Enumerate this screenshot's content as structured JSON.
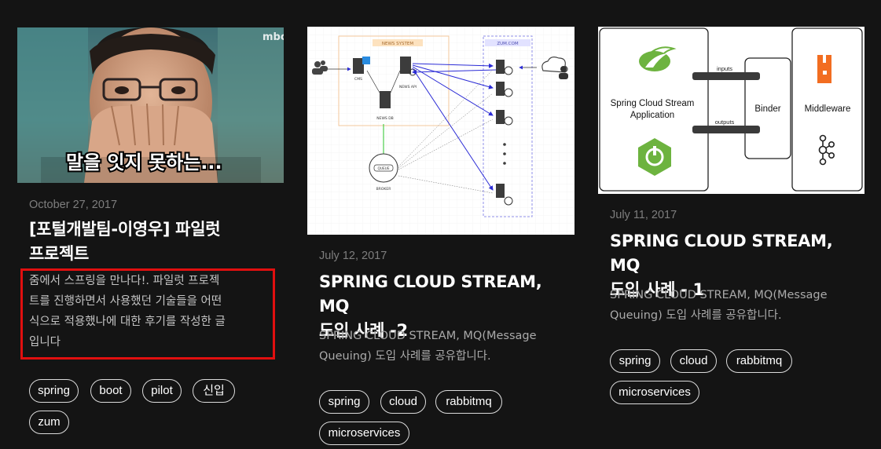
{
  "posts": [
    {
      "image_caption": "말을 잇지 못하는...",
      "image_logo": "mbc",
      "date": "October 27, 2017",
      "title": "[포털개발팀-이영우] 파일럿 프로젝트",
      "title_lines": [
        "[포털개발팀-이영우] 파일럿",
        "프로젝트"
      ],
      "desc_lines": [
        "줌에서 스프링을 만나다!. 파일럿 프로젝",
        "트를 진행하면서 사용했던 기술들을 어떤",
        "식으로 적용했나에 대한 후기를 작성한 글",
        "입니다"
      ],
      "tags": [
        "spring",
        "boot",
        "pilot",
        "신입",
        "zum"
      ]
    },
    {
      "diagram": {
        "news_system": "NEWS SYSTEM",
        "zum_com": "ZUM.COM",
        "cms": "CMS",
        "news_api": "NEWS API",
        "news_db": "NEWS DB",
        "queue": "QUEUE",
        "broker": "BROKER"
      },
      "date": "July 12, 2017",
      "title_lines": [
        "SPRING CLOUD STREAM, MQ",
        "도입 사례 -2"
      ],
      "desc_lines": [
        "SPRING CLOUD STREAM, MQ(Message",
        "Queuing) 도입 사례를 공유합니다."
      ],
      "tags": [
        "spring",
        "cloud",
        "rabbitmq",
        "microservices"
      ]
    },
    {
      "diagram": {
        "app": [
          "Spring Cloud Stream",
          "Application"
        ],
        "inputs": "inputs",
        "outputs": "outputs",
        "binder": "Binder",
        "middleware": "Middleware"
      },
      "date": "July 11, 2017",
      "title_lines": [
        "SPRING CLOUD STREAM, MQ",
        "도입 사례 - 1"
      ],
      "desc_lines": [
        "SPRING CLOUD STREAM, MQ(Message",
        "Queuing) 도입 사례를 공유합니다."
      ],
      "tags": [
        "spring",
        "cloud",
        "rabbitmq",
        "microservices"
      ]
    }
  ],
  "colors": {
    "background": "#141414",
    "highlight": "#e10f0f",
    "spring_green": "#6db33f",
    "rabbitmq_orange": "#f26d21"
  }
}
